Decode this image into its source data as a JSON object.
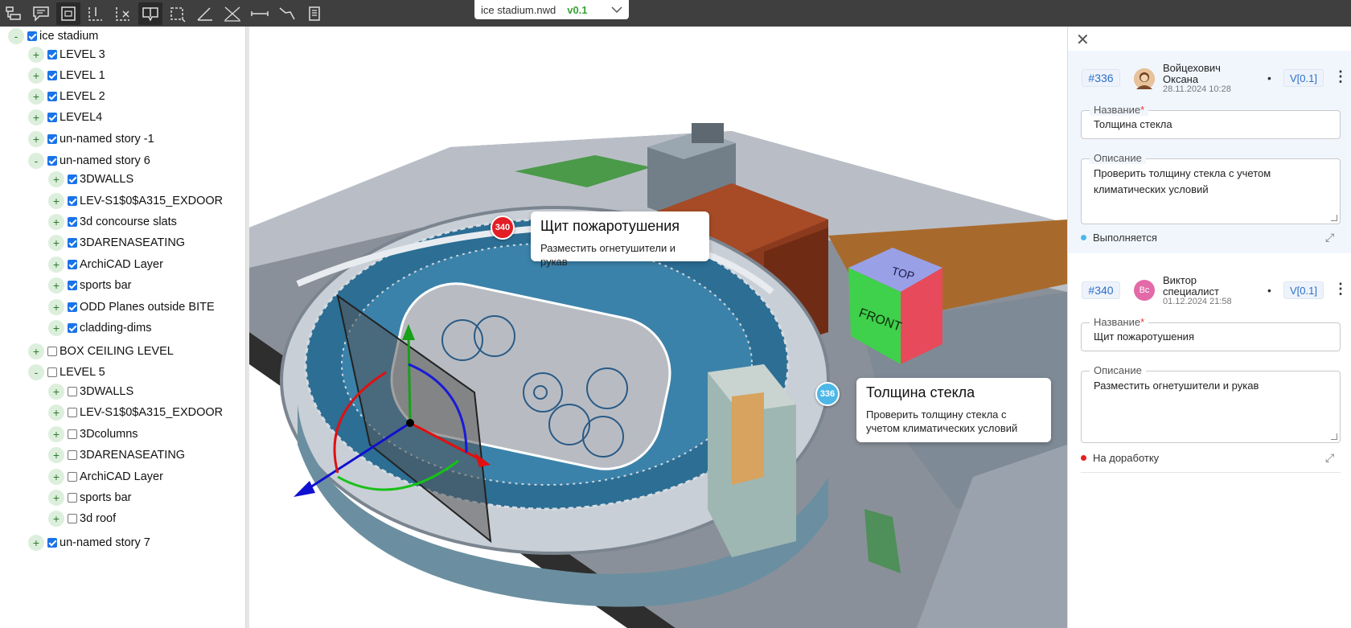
{
  "toolbar": {
    "file_name": "ice stadium.nwd",
    "file_version": "v0.1",
    "tools": [
      "tree-tool-icon",
      "comment-tool-icon",
      "box-select-icon",
      "section-plane-icon",
      "section-cut-icon",
      "split-view-icon",
      "section-box-icon",
      "angle-measure-icon",
      "point-measure-icon",
      "distance-measure-icon",
      "polyline-measure-icon",
      "area-measure-icon"
    ]
  },
  "tree": {
    "root": "ice stadium",
    "items": [
      {
        "label": "LEVEL 3"
      },
      {
        "label": "LEVEL 1"
      },
      {
        "label": "LEVEL 2"
      },
      {
        "label": "LEVEL4"
      },
      {
        "label": "un-named story -1"
      },
      {
        "label": "un-named story 6"
      },
      {
        "label": "3DWALLS"
      },
      {
        "label": "LEV-S1$0$A315_EXDOOR"
      },
      {
        "label": "3d concourse slats"
      },
      {
        "label": "3DARENASEATING"
      },
      {
        "label": "ArchiCAD Layer"
      },
      {
        "label": "sports bar"
      },
      {
        "label": "ODD Planes outside BITE"
      },
      {
        "label": "cladding-dims"
      },
      {
        "label": "BOX CEILING LEVEL"
      },
      {
        "label": "LEVEL 5"
      },
      {
        "label": "3DWALLS"
      },
      {
        "label": "LEV-S1$0$A315_EXDOOR"
      },
      {
        "label": "3Dcolumns"
      },
      {
        "label": "3DARENASEATING"
      },
      {
        "label": "ArchiCAD Layer"
      },
      {
        "label": "sports bar"
      },
      {
        "label": "3d roof"
      },
      {
        "label": "un-named story 7"
      }
    ]
  },
  "viewport": {
    "callouts": [
      {
        "id": "340",
        "title": "Щит пожаротушения",
        "text": "Разместить огнетушители и рукав",
        "color": "#e31e24"
      },
      {
        "id": "336",
        "title": "Толщина стекла",
        "text_line1": "Проверить толщину стекла с",
        "text_line2": "учетом климатических условий",
        "color": "#4db8e8"
      }
    ],
    "navcube": {
      "top": "TOP",
      "front": "FRONT"
    }
  },
  "issues": [
    {
      "id": "#336",
      "author": "Войцехович Оксана",
      "date": "28.11.2024 10:28",
      "dot": "•",
      "version": "V[0.1]",
      "name_label": "Название",
      "required": "*",
      "name": "Толщина стекла",
      "desc_label": "Описание",
      "desc_line1": "Проверить толщину стекла с учетом",
      "desc_line2": "климатических условий",
      "status": "Выполняется",
      "status_color": "#4db8e8"
    },
    {
      "id": "#340",
      "author": "Виктор специалист",
      "initials": "Вс",
      "date": "01.12.2024 21:58",
      "dot": "•",
      "version": "V[0.1]",
      "name_label": "Название",
      "required": "*",
      "name": "Щит пожаротушения",
      "desc_label": "Описание",
      "desc": "Разместить огнетушители и рукав",
      "status": "На доработку",
      "status_color": "#e31e24"
    }
  ]
}
